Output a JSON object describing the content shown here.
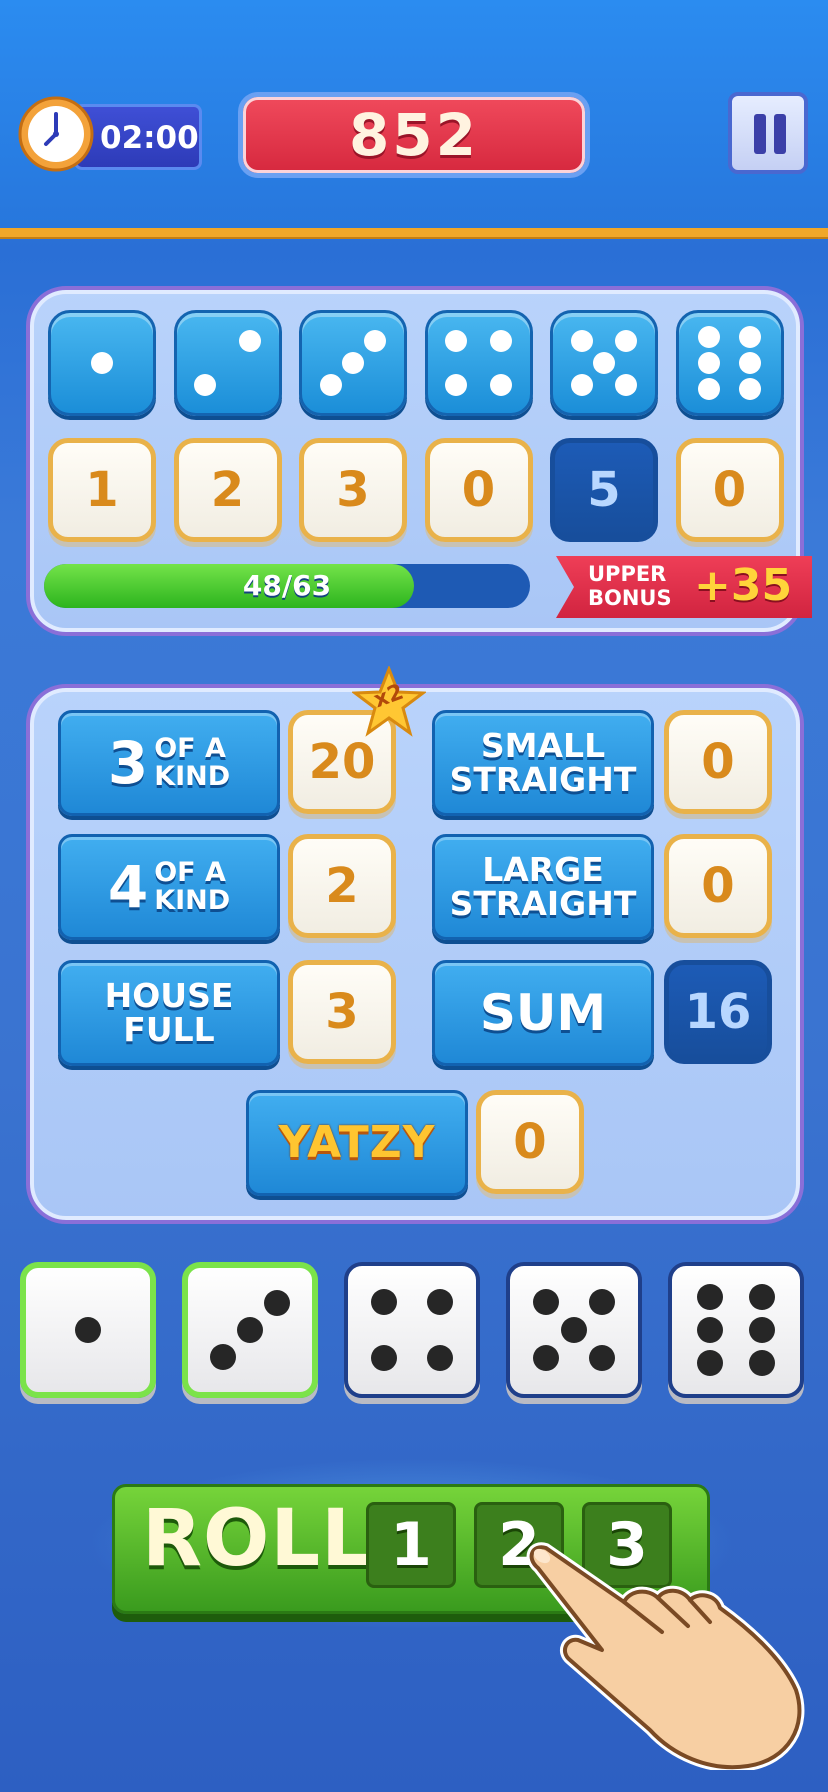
{
  "timer": {
    "value": "02:00"
  },
  "score": {
    "value": "852"
  },
  "upper": {
    "dice_faces": [
      1,
      2,
      3,
      4,
      5,
      6
    ],
    "scores": [
      "1",
      "2",
      "3",
      "0",
      "5",
      "0"
    ],
    "selected_index": 4,
    "progress": {
      "label": "48/63",
      "value": 48,
      "max": 63
    },
    "bonus": {
      "label": "UPPER BONUS",
      "value": "+35"
    }
  },
  "lower": {
    "three_kind": {
      "big": "3",
      "small_1": "OF A",
      "small_2": "KIND",
      "score": "20",
      "multiplier": "x2"
    },
    "four_kind": {
      "big": "4",
      "small_1": "OF A",
      "small_2": "KIND",
      "score": "2"
    },
    "house_full": {
      "line_1": "HOUSE",
      "line_2": "FULL",
      "score": "3"
    },
    "small_straight": {
      "line_1": "SMALL",
      "line_2": "STRAIGHT",
      "score": "0"
    },
    "large_straight": {
      "line_1": "LARGE",
      "line_2": "STRAIGHT",
      "score": "0"
    },
    "sum": {
      "label": "SUM",
      "score": "16"
    },
    "yatzy": {
      "label": "YATZY",
      "score": "0"
    }
  },
  "dice": [
    {
      "face": 1,
      "held": true
    },
    {
      "face": 3,
      "held": true
    },
    {
      "face": 4,
      "held": false
    },
    {
      "face": 5,
      "held": false
    },
    {
      "face": 6,
      "held": false
    }
  ],
  "roll": {
    "label": "ROLL",
    "counters": [
      "1",
      "2",
      "3"
    ]
  },
  "colors": {
    "accent_gold": "#f0a72a",
    "score_red": "#d6283e",
    "roll_green": "#3a9b1e",
    "held_green": "#7be34a"
  }
}
